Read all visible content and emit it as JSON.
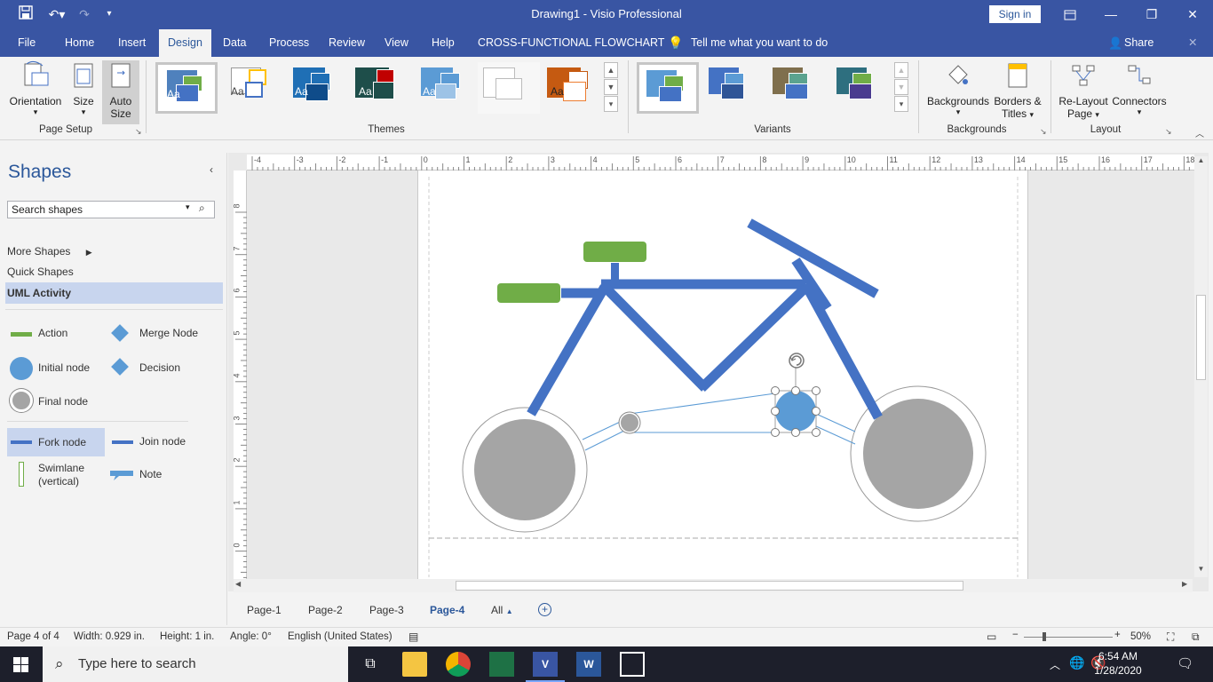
{
  "titlebar": {
    "title": "Drawing1 - Visio Professional",
    "signin_label": "Sign in"
  },
  "menu": {
    "items": [
      "File",
      "Home",
      "Insert",
      "Design",
      "Data",
      "Process",
      "Review",
      "View",
      "Help",
      "CROSS-FUNCTIONAL FLOWCHART"
    ],
    "tell_me": "Tell me what you want to do",
    "share": "Share"
  },
  "ribbon": {
    "orientation": "Orientation",
    "size": "Size",
    "auto_size_1": "Auto",
    "auto_size_2": "Size",
    "page_setup": "Page Setup",
    "themes": "Themes",
    "theme_aa": "Aa",
    "variants": "Variants",
    "backgrounds_btn": "Backgrounds",
    "borders_titles_1": "Borders &",
    "borders_titles_2": "Titles",
    "backgrounds_group": "Backgrounds",
    "relayout_1": "Re-Layout",
    "relayout_2": "Page",
    "connectors": "Connectors",
    "layout_group": "Layout"
  },
  "shapes_pane": {
    "title": "Shapes",
    "search_placeholder": "Search shapes",
    "more_shapes": "More Shapes",
    "quick_shapes": "Quick Shapes",
    "uml_activity": "UML Activity",
    "stencils": {
      "action": "Action",
      "merge_node": "Merge Node",
      "initial_node": "Initial node",
      "decision": "Decision",
      "final_node": "Final node",
      "fork_node": "Fork node",
      "join_node": "Join node",
      "swimlane_1": "Swimlane",
      "swimlane_2": "(vertical)",
      "note": "Note"
    }
  },
  "ruler_top": [
    "-4",
    "-3",
    "-2",
    "-1",
    "0",
    "1",
    "2",
    "3",
    "4",
    "5",
    "6",
    "7",
    "8",
    "9",
    "10",
    "11",
    "12",
    "13",
    "14",
    "15",
    "16",
    "17",
    "18"
  ],
  "ruler_left": [
    "8",
    "7",
    "6",
    "5",
    "4",
    "3",
    "2",
    "1",
    "0"
  ],
  "page_tabs": [
    "Page-1",
    "Page-2",
    "Page-3",
    "Page-4",
    "All"
  ],
  "status": {
    "page": "Page 4 of 4",
    "width": "Width: 0.929 in.",
    "height": "Height: 1 in.",
    "angle": "Angle: 0°",
    "language": "English (United States)",
    "zoom": "50%"
  },
  "taskbar": {
    "search_placeholder": "Type here to search",
    "time": "6:54 AM",
    "date": "1/28/2020"
  },
  "colors": {
    "title_blue": "#3955a3",
    "shape_blue": "#4472c4",
    "shape_green": "#70ad47",
    "wheel_gray": "#a5a5a5",
    "node_blue": "#5b9bd5"
  }
}
